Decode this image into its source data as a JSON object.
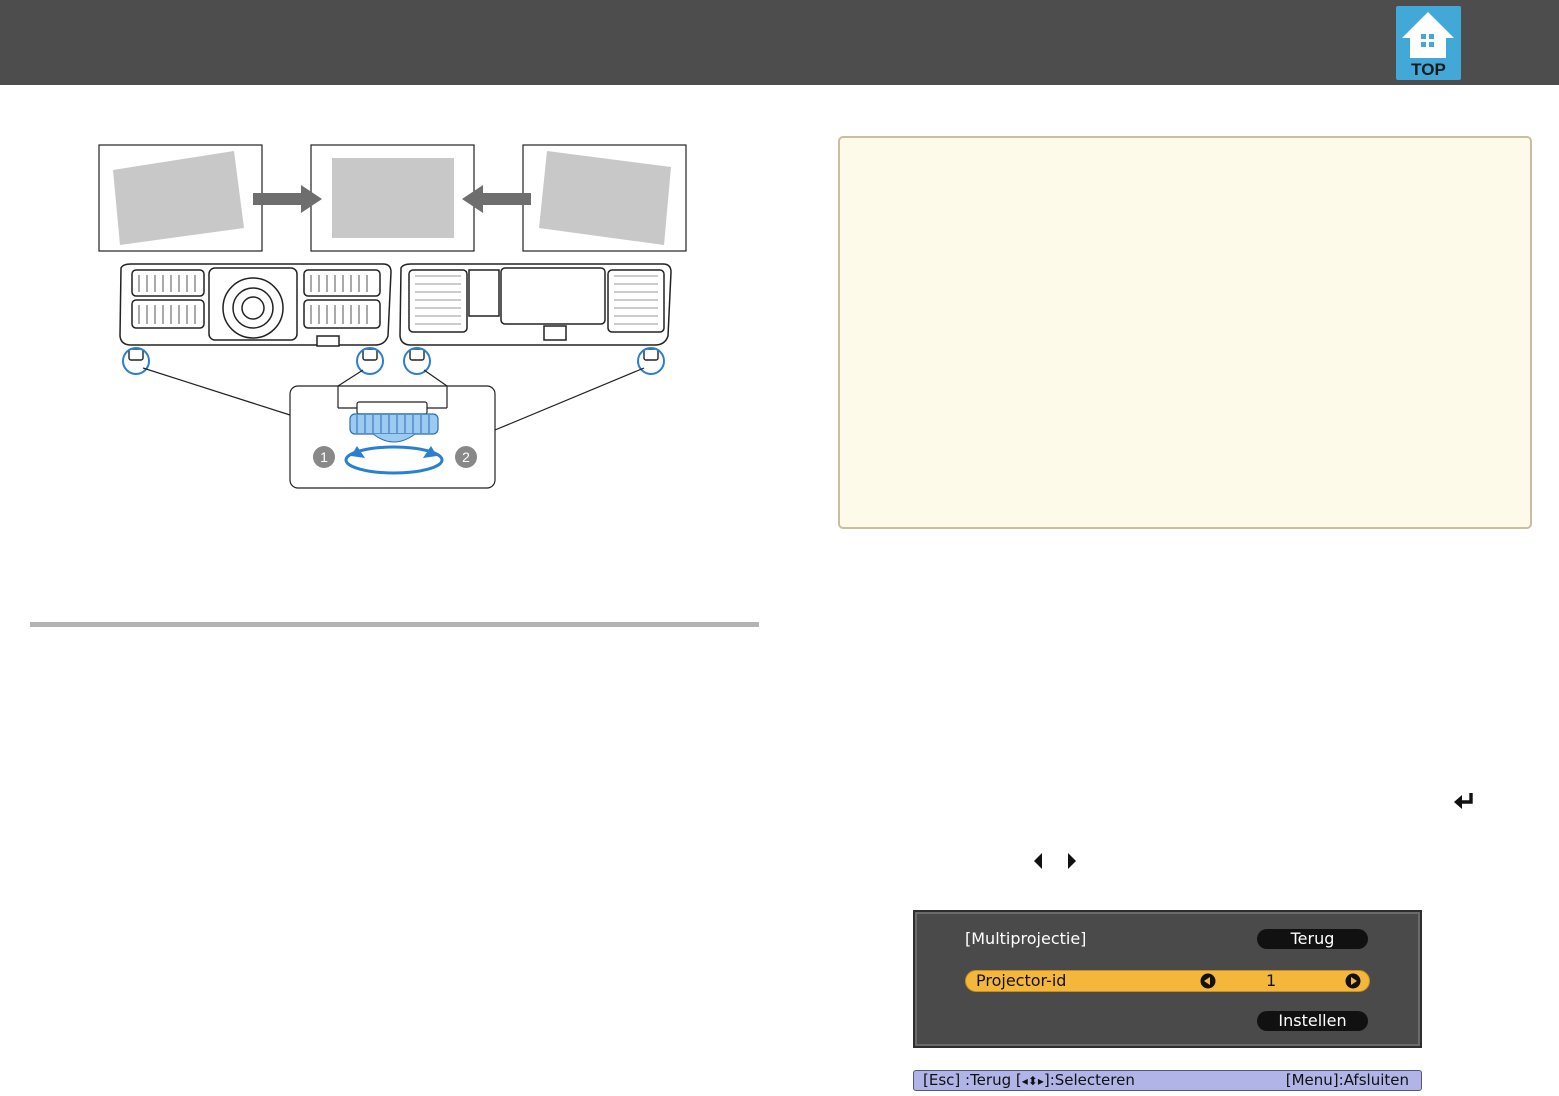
{
  "header": {
    "top_button_label": "TOP"
  },
  "figure": {
    "callouts": [
      "1",
      "2"
    ]
  },
  "menu": {
    "title": "[Multiprojectie]",
    "back_button": "Terug",
    "row_label": "Projector-id",
    "row_value": "1",
    "set_button": "Instellen"
  },
  "status_bar": {
    "esc": "[Esc] :Terug",
    "select_prefix": "[",
    "select_glyph": "◂⬍▸",
    "select_suffix": "]:Selecteren",
    "menu": "[Menu]:Afsluiten"
  },
  "colors": {
    "header": "#4d4d4d",
    "top_button": "#41a8d8",
    "note_background": "#fdfaea",
    "menu_highlight": "#f5b73b",
    "status_bar": "#b1b4e6"
  },
  "icons": {
    "enter": "enter-return-icon",
    "left": "triangle-left-icon",
    "right": "triangle-right-icon"
  }
}
